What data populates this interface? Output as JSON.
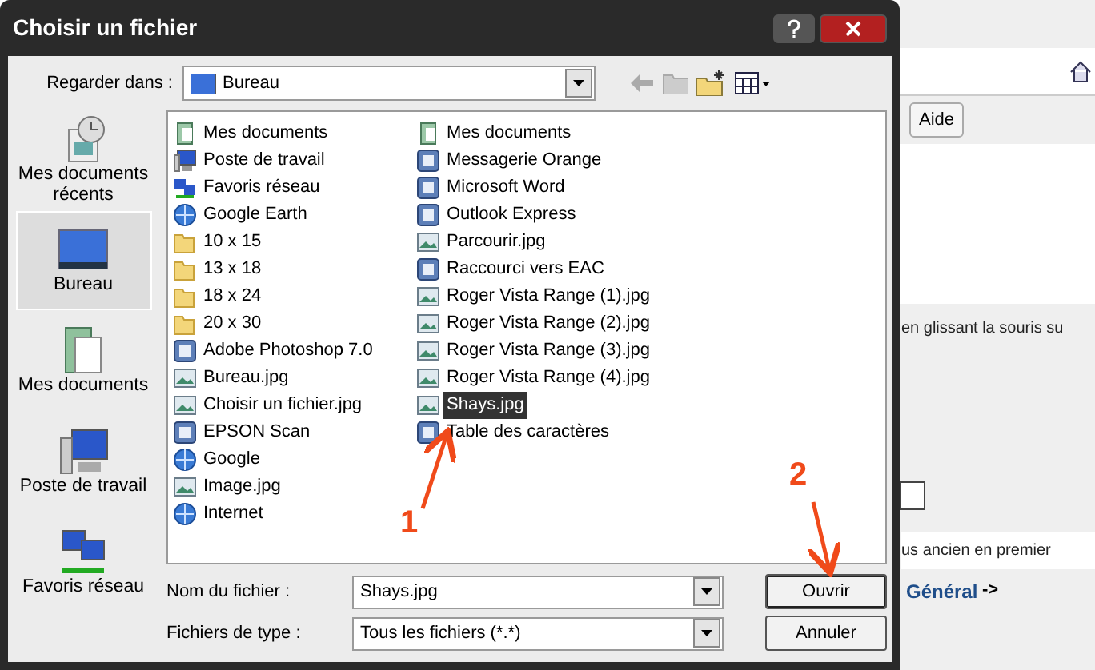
{
  "window": {
    "title": "Choisir un fichier"
  },
  "look_in": {
    "label": "Regarder dans :",
    "value": "Bureau"
  },
  "places": [
    {
      "label": "Mes documents récents",
      "kind": "recent",
      "selected": false
    },
    {
      "label": "Bureau",
      "kind": "desktop",
      "selected": true
    },
    {
      "label": "Mes documents",
      "kind": "documents",
      "selected": false
    },
    {
      "label": "Poste de travail",
      "kind": "computer",
      "selected": false
    },
    {
      "label": "Favoris réseau",
      "kind": "network",
      "selected": false
    }
  ],
  "files": [
    {
      "name": "Mes documents",
      "kind": "documents",
      "selected": false
    },
    {
      "name": "Poste de travail",
      "kind": "computer",
      "selected": false
    },
    {
      "name": "Favoris réseau",
      "kind": "network",
      "selected": false
    },
    {
      "name": "Google Earth",
      "kind": "globe",
      "selected": false
    },
    {
      "name": "10 x 15",
      "kind": "folder",
      "selected": false
    },
    {
      "name": "13 x 18",
      "kind": "folder",
      "selected": false
    },
    {
      "name": "18 x 24",
      "kind": "folder",
      "selected": false
    },
    {
      "name": "20 x 30",
      "kind": "folder",
      "selected": false
    },
    {
      "name": "Adobe Photoshop 7.0",
      "kind": "app",
      "selected": false
    },
    {
      "name": "Bureau.jpg",
      "kind": "image",
      "selected": false
    },
    {
      "name": "Choisir un fichier.jpg",
      "kind": "image",
      "selected": false
    },
    {
      "name": "EPSON Scan",
      "kind": "app",
      "selected": false
    },
    {
      "name": "Google",
      "kind": "globe",
      "selected": false
    },
    {
      "name": "Image.jpg",
      "kind": "image",
      "selected": false
    },
    {
      "name": "Internet",
      "kind": "globe",
      "selected": false
    },
    {
      "name": "Mes documents",
      "kind": "documents",
      "selected": false
    },
    {
      "name": "Messagerie Orange",
      "kind": "app",
      "selected": false
    },
    {
      "name": "Microsoft Word",
      "kind": "app",
      "selected": false
    },
    {
      "name": "Outlook Express",
      "kind": "app",
      "selected": false
    },
    {
      "name": "Parcourir.jpg",
      "kind": "image",
      "selected": false
    },
    {
      "name": "Raccourci vers EAC",
      "kind": "app",
      "selected": false
    },
    {
      "name": "Roger Vista Range (1).jpg",
      "kind": "image",
      "selected": false
    },
    {
      "name": "Roger Vista Range (2).jpg",
      "kind": "image",
      "selected": false
    },
    {
      "name": "Roger Vista Range (3).jpg",
      "kind": "image",
      "selected": false
    },
    {
      "name": "Roger Vista Range (4).jpg",
      "kind": "image",
      "selected": false
    },
    {
      "name": "Shays.jpg",
      "kind": "image",
      "selected": true
    },
    {
      "name": "Table des caractères",
      "kind": "app",
      "selected": false
    }
  ],
  "file_name": {
    "label": "Nom du fichier :",
    "value": "Shays.jpg"
  },
  "file_type": {
    "label": "Fichiers de type :",
    "value": "Tous les fichiers (*.*)"
  },
  "buttons": [
    "Ouvrir",
    "Annuler"
  ],
  "background_page": {
    "button": "Aide",
    "text_1": "en glissant la souris su",
    "text_2": "us ancien en premier",
    "link": "Général",
    "link_arrow": "->"
  },
  "annotations": [
    {
      "label": "1"
    },
    {
      "label": "2"
    }
  ]
}
